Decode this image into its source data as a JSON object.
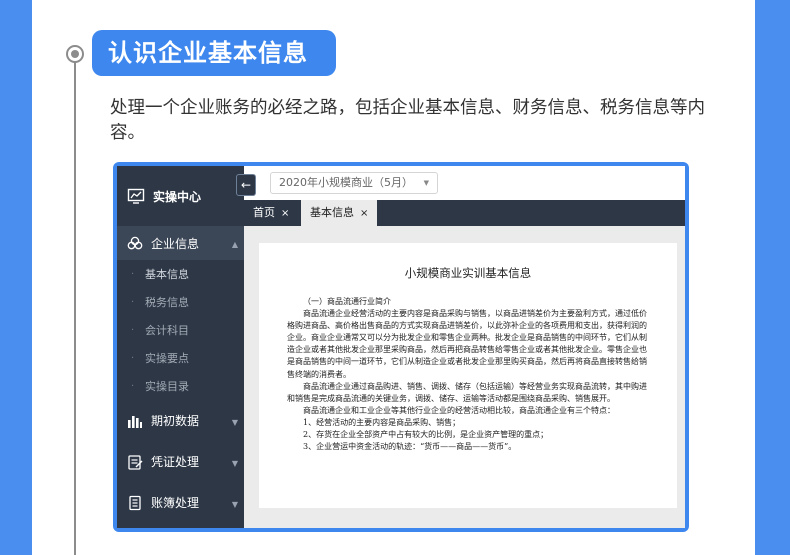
{
  "colors": {
    "brand_blue": "#3d87ee",
    "sidebar_bg": "#2d3746"
  },
  "section": {
    "title": "认识企业基本信息",
    "description": "处理一个企业账务的必经之路，包括企业基本信息、财务信息、税务信息等内容。"
  },
  "app": {
    "sidebar": {
      "header": "实操中心",
      "groups": [
        {
          "label": "企业信息",
          "icon": "cloud-icon",
          "expanded": true
        },
        {
          "label": "期初数据",
          "icon": "bar-chart-icon"
        },
        {
          "label": "凭证处理",
          "icon": "voucher-icon"
        },
        {
          "label": "账簿处理",
          "icon": "ledger-icon"
        }
      ],
      "subitems": [
        "基本信息",
        "税务信息",
        "会计科目",
        "实操要点",
        "实操目录"
      ]
    },
    "collapse_icon": "←",
    "period_select": {
      "value": "2020年小规模商业（5月）"
    },
    "tabs": [
      {
        "label": "首页",
        "close": "×"
      },
      {
        "label": "基本信息",
        "close": "×"
      }
    ],
    "document": {
      "title": "小规模商业实训基本信息",
      "section_heading": "（一）商品流通行业简介",
      "paragraphs": [
        "商品流通企业经营活动的主要内容是商品采购与销售，以商品进销差价为主要盈利方式，通过低价格购进商品、高价格出售商品的方式实现商品进销差价，以此弥补企业的各项费用和支出，获得利润的企业。商业企业通常又可以分为批发企业和零售企业两种。批发企业是商品销售的中间环节，它们从制造企业或者其他批发企业那里采购商品，然后再把商品转售给零售企业或者其他批发企业。零售企业也是商品销售的中间一道环节，它们从制造企业或者批发企业那里购买商品，然后再将商品直接转售给销售终端的消费者。",
        "商品流通企业通过商品购进、销售、调拨、储存（包括运输）等经营业务实现商品流转，其中购进和销售是完成商品流通的关键业务，调拨、储存、运输等活动都是围绕商品采购、销售展开。",
        "商品流通企业和工业企业等其他行业企业的经营活动相比较，商品流通企业有三个特点："
      ],
      "points": [
        "1、经营活动的主要内容是商品采购、销售；",
        "2、存货在企业全部资产中占有较大的比例，是企业资产管理的重点；",
        "3、企业营运中资金活动的轨迹：“货币——商品——货币”。"
      ]
    }
  }
}
